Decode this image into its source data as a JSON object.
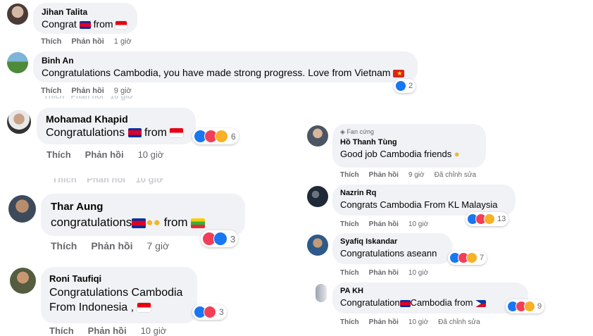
{
  "actions": {
    "like": "Thích",
    "reply": "Phản hồi",
    "edited": "Đã chỉnh sửa"
  },
  "comments": [
    {
      "name": "Jihan Talita",
      "text": "Congrat",
      "text2": "from",
      "time": "1 giờ"
    },
    {
      "name": "Binh An",
      "text": "Congratulations Cambodia, you have made strong progress. Love from Vietnam",
      "time": "9 giờ",
      "reactions": "2"
    },
    {
      "name": "Mohamad Khapid",
      "text": "Congratulations",
      "text2": "from",
      "time": "10 giờ",
      "reactions": "6"
    },
    {
      "name": "Thar Aung",
      "text": "congratulations",
      "text2": "from",
      "time": "7 giờ",
      "reactions": "3"
    },
    {
      "name": "Roni Taufiqi",
      "text": "Congratulations Cambodia",
      "text_line2": "From Indonesia ,",
      "time": "10 giờ",
      "reactions": "3"
    },
    {
      "badge": "Fan cứng",
      "name": "Hồ Thanh Tùng",
      "text": "Good job Cambodia friends",
      "time": "9 giờ"
    },
    {
      "name": "Nazrin Rq",
      "text": "Congrats Cambodia From KL Malaysia",
      "time": "10 giờ",
      "reactions": "13"
    },
    {
      "name": "Syafiq Iskandar",
      "text": "Congratulations aseann",
      "time": "10 giờ",
      "reactions": "7"
    },
    {
      "name": "PA KH",
      "text": "Congratulation",
      "text2": "Cambodia from",
      "time": "10 giờ",
      "reactions": "9"
    }
  ],
  "icons": [
    "like-reaction-icon",
    "love-reaction-icon",
    "care-reaction-icon",
    "clap-emoji-icon",
    "verified-badge-icon",
    "flag-icon"
  ],
  "colors": {
    "bubble": "#f0f2f5",
    "meta": "#65676b",
    "like": "#1877f2",
    "love": "#f33e58",
    "care": "#f7b125"
  }
}
